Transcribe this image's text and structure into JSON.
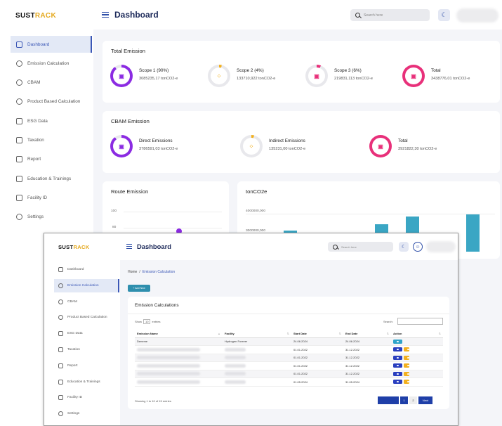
{
  "brand": {
    "logo_part1": "SUST",
    "logo_part2": "RACK",
    "accent": "#e5a91e",
    "primary": "#2f4fa8"
  },
  "back": {
    "header": {
      "title": "Dashboard",
      "search_placeholder": "Search here"
    },
    "sidebar": [
      {
        "label": "Dashboard",
        "icon": "grid-icon",
        "active": true
      },
      {
        "label": "Emission Calculation",
        "icon": "gear-icon"
      },
      {
        "label": "CBAM",
        "icon": "gear-icon"
      },
      {
        "label": "Product Based Calculation",
        "icon": "gear-icon"
      },
      {
        "label": "ESG Data",
        "icon": "calendar-icon"
      },
      {
        "label": "Taxation",
        "icon": "database-icon"
      },
      {
        "label": "Report",
        "icon": "document-icon"
      },
      {
        "label": "Education & Trainings",
        "icon": "book-icon"
      },
      {
        "label": "Facility ID",
        "icon": "id-card-icon"
      },
      {
        "label": "Settings",
        "icon": "gear-icon"
      }
    ],
    "total_emission": {
      "title": "Total Emission",
      "items": [
        {
          "name": "Scope 1 (90%)",
          "value": "3085235,17 tonCO2-e",
          "color": "#8b2be2",
          "progress": 0.9
        },
        {
          "name": "Scope 2 (4%)",
          "value": "133710,922 tonCO2-e",
          "color": "#f2b01e",
          "progress": 0.04
        },
        {
          "name": "Scope 3 (6%)",
          "value": "219831,113 tonCO2-e",
          "color": "#e8307a",
          "progress": 0.06
        },
        {
          "name": "Total",
          "value": "3438776,01 tonCO2-e",
          "color": "#e8307a",
          "progress": 1.0
        }
      ]
    },
    "cbam_emission": {
      "title": "CBAM Emission",
      "items": [
        {
          "name": "Direct Emissions",
          "value": "3786591,03 tonCO2-e",
          "color": "#8b2be2",
          "progress": 0.9
        },
        {
          "name": "Indirect Emissions",
          "value": "135231,00 tonCO2-e",
          "color": "#f2b01e",
          "progress": 0.04
        },
        {
          "name": "Total",
          "value": "3921822,30 tonCO2-e",
          "color": "#e8307a",
          "progress": 1.0
        }
      ]
    },
    "route_emission": {
      "title": "Route Emission",
      "ticks": [
        "100",
        "80"
      ]
    },
    "ton_chart": {
      "title": "tonCO2e",
      "ticks": [
        "4000000,000",
        "3000000,000"
      ]
    }
  },
  "front": {
    "header": {
      "title": "Dashboard",
      "search_placeholder": "Search here"
    },
    "sidebar": [
      {
        "label": "Dashboard",
        "icon": "grid-icon"
      },
      {
        "label": "Emission Calculation",
        "icon": "gear-icon",
        "active": true
      },
      {
        "label": "CBAM",
        "icon": "gear-icon"
      },
      {
        "label": "Product Based Calculation",
        "icon": "gear-icon"
      },
      {
        "label": "ESG Data",
        "icon": "calendar-icon"
      },
      {
        "label": "Taxation",
        "icon": "database-icon"
      },
      {
        "label": "Report",
        "icon": "document-icon"
      },
      {
        "label": "Education & Trainings",
        "icon": "book-icon"
      },
      {
        "label": "Facility ID",
        "icon": "id-card-icon"
      },
      {
        "label": "Settings",
        "icon": "gear-icon"
      }
    ],
    "breadcrumb": {
      "home": "Home",
      "current": "Emission Calculation"
    },
    "add_button": "+ Add New",
    "table_card": {
      "title": "Emission Calculations",
      "show_prefix": "Show",
      "show_value": "10",
      "show_suffix": "entries",
      "search_label": "Search:",
      "columns": [
        "Emission Name",
        "Facility",
        "Start Date",
        "End Date",
        "Action"
      ],
      "rows": [
        {
          "name": "Deneme",
          "facility": "Hydrogen Forever",
          "start": "24.06.2024",
          "end": "24.06.2024"
        },
        {
          "name": "",
          "facility": "",
          "start": "01.01.2022",
          "end": "31.12.2022"
        },
        {
          "name": "",
          "facility": "",
          "start": "01.01.2022",
          "end": "31.12.2022"
        },
        {
          "name": "",
          "facility": "",
          "start": "01.01.2022",
          "end": "31.12.2022"
        },
        {
          "name": "",
          "facility": "",
          "start": "01.01.2022",
          "end": "31.12.2022"
        },
        {
          "name": "",
          "facility": "",
          "start": "01.05.2024",
          "end": "31.05.2024"
        }
      ],
      "showing": "Showing 1 to 10 of 15 entries",
      "pagination": {
        "prev": "Previous",
        "p1": "1",
        "p2": "2",
        "next": "Next"
      }
    }
  }
}
